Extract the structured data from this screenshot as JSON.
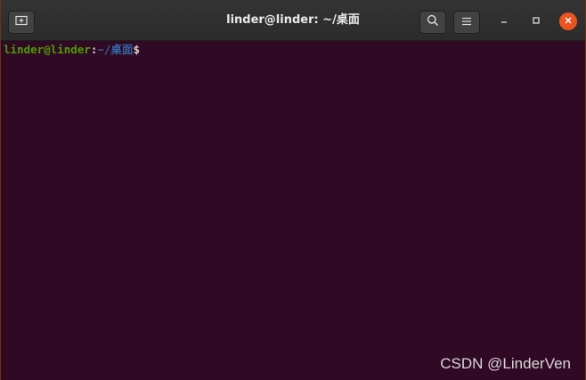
{
  "window": {
    "title": "linder@linder: ~/桌面"
  },
  "header": {
    "new_tab_icon": "new-tab-icon",
    "search_icon": "search-icon",
    "menu_icon": "hamburger-menu-icon",
    "minimize_icon": "minimize-icon",
    "maximize_icon": "maximize-icon",
    "close_icon": "close-icon"
  },
  "terminal": {
    "prompt_user": "linder@linder",
    "prompt_sep": ":",
    "prompt_path": "~/桌面",
    "prompt_symbol": "$"
  },
  "watermark": {
    "text": "CSDN @LinderVen"
  },
  "colors": {
    "terminal_bg": "#300a24",
    "titlebar_bg": "#2f2f2f",
    "prompt_user": "#4e9a06",
    "prompt_path": "#3465a4",
    "close_button": "#e95420"
  }
}
